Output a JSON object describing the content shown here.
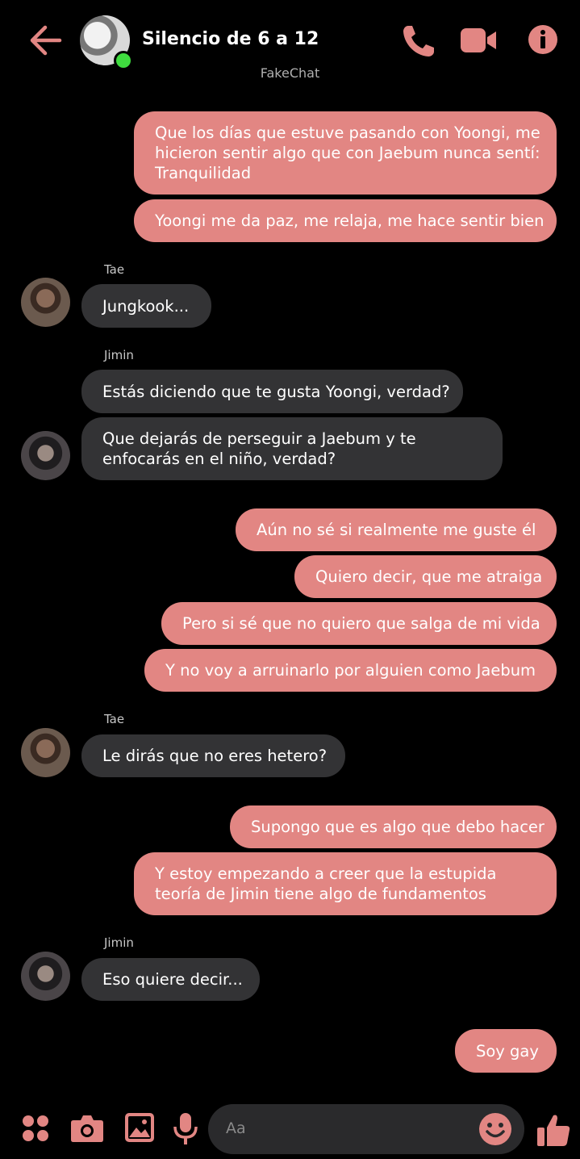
{
  "header": {
    "title": "Silencio de 6 a 12",
    "subtitle": "FakeChat",
    "accent": "#e28683"
  },
  "messages": [
    {
      "side": "out",
      "lines": [
        "Que los días que estuve pasando con Yoongi, me",
        "hicieron sentir algo que con Jaebum nunca sentí:",
        "Tranquilidad"
      ]
    },
    {
      "side": "out",
      "lines": [
        "Yoongi me da paz, me relaja, me hace sentir bien"
      ]
    },
    {
      "side": "in",
      "sender": "Tae",
      "lines": [
        "Jungkook..."
      ]
    },
    {
      "side": "in",
      "sender": "Jimin",
      "lines": [
        "Estás diciendo que te gusta Yoongi, verdad?"
      ]
    },
    {
      "side": "in",
      "lines": [
        "Que dejarás de perseguir a Jaebum y te",
        "enfocarás en el niño, verdad?"
      ]
    },
    {
      "side": "out",
      "lines": [
        "Aún no sé si realmente me guste él"
      ]
    },
    {
      "side": "out",
      "lines": [
        "Quiero decir, que me atraiga"
      ]
    },
    {
      "side": "out",
      "lines": [
        "Pero si sé que no quiero que salga de mi vida"
      ]
    },
    {
      "side": "out",
      "lines": [
        "Y no voy a arruinarlo por alguien como Jaebum"
      ]
    },
    {
      "side": "in",
      "sender": "Tae",
      "lines": [
        "Le dirás que no eres hetero?"
      ]
    },
    {
      "side": "out",
      "lines": [
        "Supongo que es algo que debo hacer"
      ]
    },
    {
      "side": "out",
      "lines": [
        "Y estoy empezando a creer que la estupida",
        "teoría de Jimin tiene algo de fundamentos"
      ]
    },
    {
      "side": "in",
      "sender": "Jimin",
      "lines": [
        "Eso quiere decir..."
      ]
    },
    {
      "side": "out",
      "lines": [
        "Soy gay"
      ]
    }
  ],
  "composer": {
    "placeholder": "Aa",
    "icons": [
      "menu-dots-icon",
      "camera-icon",
      "image-icon",
      "mic-icon",
      "emoji-icon",
      "thumbs-up-icon"
    ]
  }
}
